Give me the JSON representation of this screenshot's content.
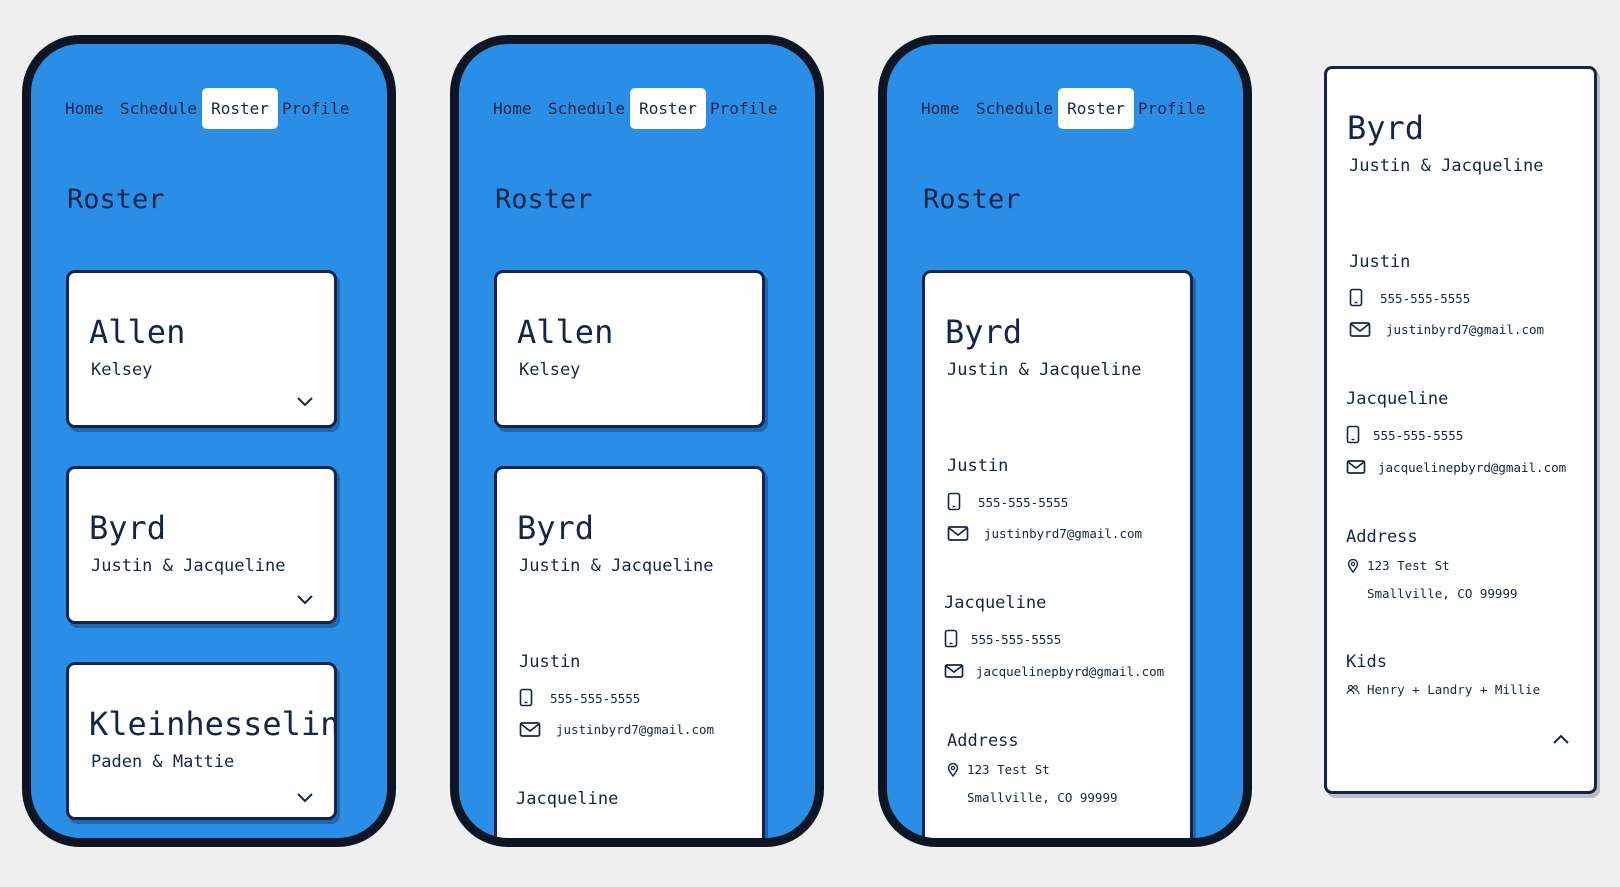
{
  "nav": {
    "items": [
      "Home",
      "Schedule",
      "Roster",
      "Profile"
    ],
    "active": "Roster"
  },
  "page_title": "Roster",
  "families": {
    "allen": {
      "name": "Allen",
      "members": "Kelsey"
    },
    "byrd": {
      "name": "Byrd",
      "members": "Justin & Jacqueline",
      "people": [
        {
          "name": "Justin",
          "phone": "555-555-5555",
          "email": "justinbyrd7@gmail.com"
        },
        {
          "name": "Jacqueline",
          "phone": "555-555-5555",
          "email": "jacquelinepbyrd@gmail.com"
        }
      ],
      "address_label": "Address",
      "address_line1": "123 Test St",
      "address_line2": "Smallville, CO 99999",
      "kids_label": "Kids",
      "kids": "Henry + Landry + Millie"
    },
    "kleinhesselink": {
      "name": "Kleinhesselink",
      "members": "Paden & Mattie"
    }
  },
  "colors": {
    "background": "#efefef",
    "screen_blue": "#2a8ee7",
    "text_navy": "#13254a",
    "frame": "#0e1626",
    "card": "#ffffff"
  },
  "icons": {
    "phone": "phone-icon",
    "email": "mail-icon",
    "address": "location-pin-icon",
    "kids": "people-icon",
    "expand": "chevron-down-icon",
    "collapse": "chevron-up-icon"
  }
}
